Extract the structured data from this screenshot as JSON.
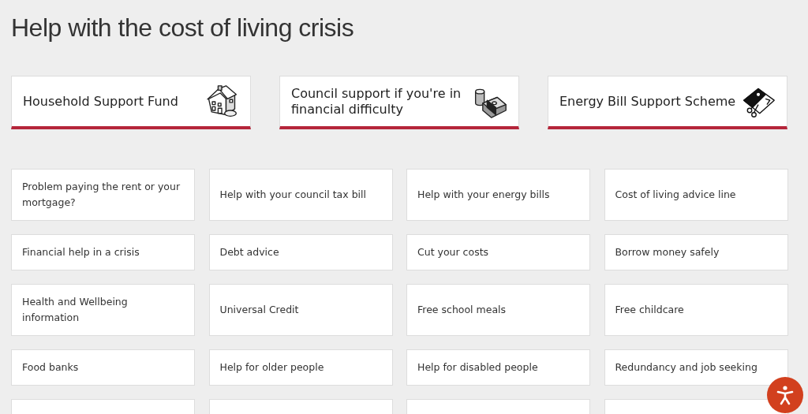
{
  "title": "Help with the cost of living crisis",
  "featured": [
    {
      "label": "Household Support Fund"
    },
    {
      "label": "Council support if you're in financial difficulty"
    },
    {
      "label": "Energy Bill Support Scheme"
    }
  ],
  "links": [
    {
      "label": "Problem paying the rent or your mortgage?"
    },
    {
      "label": "Help with your council tax bill"
    },
    {
      "label": "Help with your energy bills"
    },
    {
      "label": "Cost of living advice line"
    },
    {
      "label": "Financial help in a crisis"
    },
    {
      "label": "Debt advice"
    },
    {
      "label": "Cut your costs"
    },
    {
      "label": "Borrow money safely"
    },
    {
      "label": "Health and Wellbeing information"
    },
    {
      "label": "Universal Credit"
    },
    {
      "label": "Free school meals"
    },
    {
      "label": "Free childcare"
    },
    {
      "label": "Food banks"
    },
    {
      "label": "Help for older people"
    },
    {
      "label": "Help for disabled people"
    },
    {
      "label": "Redundancy and job seeking"
    }
  ]
}
